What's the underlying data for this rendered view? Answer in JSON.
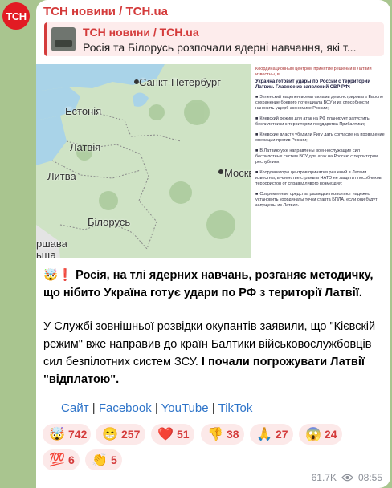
{
  "channel": {
    "name": "ТСН новини / TCH.ua",
    "avatar_text": "ТСН"
  },
  "reply": {
    "title": "ТСН новини / TCH.ua",
    "text": "Росія та Білорусь розпочали ядерні навчання, які т..."
  },
  "map_labels": {
    "st_petersburg": "Санкт-Петербург",
    "estonia": "Естонія",
    "latvia": "Латвія",
    "lithuania": "Литва",
    "moscow": "Москва",
    "belarus": "Білорусь",
    "warsaw_partial": "ршава",
    "poland_partial": "ьща"
  },
  "document": {
    "top_line": "Координационным центром принятие решений в Латвии известны, в ...",
    "heading": "Украина готовит удары по России с территории Латвии. Главное из заявлений СВР РФ:",
    "items": [
      "Зеленский нацелен всеми силами демонстрировать Европе сохранение боевого потенциала ВСУ и их способности наносить ущерб экономике России;",
      "Киевский режим для атак на РФ планирует запустить беспилотники с территории государства Прибалтики;",
      "Киевские власти убедили Ригу дать согласие на проведение операции против России;",
      "В Латвию уже направлены военнослужащие сил беспилотных систем ВСУ для атак на Россию с территории республики;",
      "Координаторы центров принятия решений в Латвии известны, в членстве страны в НАТО не защитит пособников террористов от справедливого возмездия;",
      "Современные средства разведки позволяют надежно установить координаты точки старта БПЛА, если они будут запущены из Латвии."
    ]
  },
  "caption": {
    "bold": "Росія, на тлі ядерних навчань, розганяє методичку, що нібито Україна готує удари по РФ з території Латвії.",
    "para2_regular": "У Службі зовнішньої розвідки окупантів заявили, що \"Кієвскій режим\" вже направив до країн Балтики військовослужбовців сил безпілотних систем ЗСУ.",
    "para2_bold": "І почали погрожувати Латвії \"відплатою\"."
  },
  "links": [
    "Сайт",
    "Facebook",
    "YouTube",
    "TikTok"
  ],
  "reactions": [
    {
      "emoji": "🤯",
      "count": "742"
    },
    {
      "emoji": "😁",
      "count": "257"
    },
    {
      "emoji": "❤️",
      "count": "51"
    },
    {
      "emoji": "👎",
      "count": "38"
    },
    {
      "emoji": "🙏",
      "count": "27"
    },
    {
      "emoji": "😱",
      "count": "24"
    },
    {
      "emoji": "💯",
      "count": "6"
    },
    {
      "emoji": "👏",
      "count": "5"
    }
  ],
  "meta": {
    "views": "61.7K",
    "time": "08:55"
  },
  "colors": {
    "accent": "#d43b3b",
    "link": "#2e74c9",
    "background": "#a9c58f"
  }
}
